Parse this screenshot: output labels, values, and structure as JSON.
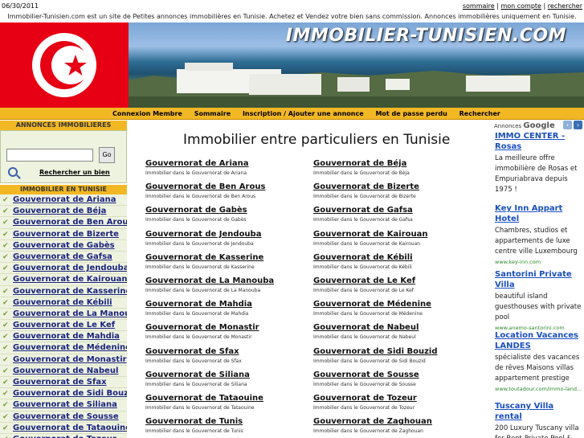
{
  "topbar": {
    "date": "06/30/2011",
    "links": [
      "sommaire",
      "mon compte",
      "rechercher"
    ],
    "separator": "|"
  },
  "intro": "Immobilier-Tunisien.com est un site de Petites annonces immobilières en Tunisie. Achetez et Vendez votre bien sans commission. Annonces immobilières uniquement en Tunisie.",
  "banner": {
    "logo_text": "IMMOBILIER-TUNISIEN.COM",
    "flag_colors": {
      "red": "#e70013",
      "white": "#ffffff"
    }
  },
  "nav": {
    "items": [
      "Connexion Membre",
      "Sommaire",
      "Inscription / Ajouter une annonce",
      "Mot de passe perdu",
      "Rechercher"
    ]
  },
  "left": {
    "header": "ANNONCES IMMOBILIERES",
    "search_value": "",
    "go_label": "Go",
    "search_link": "Rechercher un bien",
    "list_header": "IMMOBILIER EN TUNISIE",
    "items": [
      "Gouvernorat de Ariana",
      "Gouvernorat de Béja",
      "Gouvernorat de Ben Arous",
      "Gouvernorat de Bizerte",
      "Gouvernorat de Gabès",
      "Gouvernorat de Gafsa",
      "Gouvernorat de Jendouba",
      "Gouvernorat de Kairouan",
      "Gouvernorat de Kasserine",
      "Gouvernorat de Kébili",
      "Gouvernorat de La Manouba",
      "Gouvernorat de Le Kef",
      "Gouvernorat de Mahdia",
      "Gouvernorat de Médenine",
      "Gouvernorat de Monastir",
      "Gouvernorat de Nabeul",
      "Gouvernorat de Sfax",
      "Gouvernorat de Sidi Bouzid",
      "Gouvernorat de Siliana",
      "Gouvernorat de Sousse",
      "Gouvernorat de Tataouine",
      "Gouvernorat de Tozeur"
    ]
  },
  "main": {
    "title": "Immobilier entre particuliers en Tunisie",
    "entries": [
      {
        "title": "Gouvernorat de Ariana",
        "sub": "Immobilier dans le Gouvernorat de Ariana"
      },
      {
        "title": "Gouvernorat de Béja",
        "sub": "Immobilier dans le Gouvernorat de Béja"
      },
      {
        "title": "Gouvernorat de Ben Arous",
        "sub": "Immobilier dans le Gouvernorat de Ben Arous"
      },
      {
        "title": "Gouvernorat de Bizerte",
        "sub": "Immobilier dans le Gouvernorat de Bizerte"
      },
      {
        "title": "Gouvernorat de Gabès",
        "sub": "Immobilier dans le Gouvernorat de Gabès"
      },
      {
        "title": "Gouvernorat de Gafsa",
        "sub": "Immobilier dans le Gouvernorat de Gafsa"
      },
      {
        "title": "Gouvernorat de Jendouba",
        "sub": "Immobilier dans le Gouvernorat de Jendouba"
      },
      {
        "title": "Gouvernorat de Kairouan",
        "sub": "Immobilier dans le Gouvernorat de Kairouan"
      },
      {
        "title": "Gouvernorat de Kasserine",
        "sub": "Immobilier dans le Gouvernorat de Kasserine"
      },
      {
        "title": "Gouvernorat de Kébili",
        "sub": "Immobilier dans le Gouvernorat de Kébili"
      },
      {
        "title": "Gouvernorat de La Manouba",
        "sub": "Immobilier dans le Gouvernorat de La Manouba"
      },
      {
        "title": "Gouvernorat de Le Kef",
        "sub": "Immobilier dans le Gouvernorat de Le Kef"
      },
      {
        "title": "Gouvernorat de Mahdia",
        "sub": "Immobilier dans le Gouvernorat de Mahdia"
      },
      {
        "title": "Gouvernorat de Médenine",
        "sub": "Immobilier dans le Gouvernorat de Médenine"
      },
      {
        "title": "Gouvernorat de Monastir",
        "sub": "Immobilier dans le Gouvernorat de Monastir"
      },
      {
        "title": "Gouvernorat de Nabeul",
        "sub": "Immobilier dans le Gouvernorat de Nabeul"
      },
      {
        "title": "Gouvernorat de Sfax",
        "sub": "Immobilier dans le Gouvernorat de Sfax"
      },
      {
        "title": "Gouvernorat de Sidi Bouzid",
        "sub": "Immobilier dans le Gouvernorat de Sidi Bouzid"
      },
      {
        "title": "Gouvernorat de Siliana",
        "sub": "Immobilier dans le Gouvernorat de Siliana"
      },
      {
        "title": "Gouvernorat de Sousse",
        "sub": "Immobilier dans le Gouvernorat de Sousse"
      },
      {
        "title": "Gouvernorat de Tataouine",
        "sub": "Immobilier dans le Gouvernorat de Tataouine"
      },
      {
        "title": "Gouvernorat de Tozeur",
        "sub": "Immobilier dans le Gouvernorat de Tozeur"
      },
      {
        "title": "Gouvernorat de Tunis",
        "sub": "Immobilier dans le Gouvernorat de Tunis"
      },
      {
        "title": "Gouvernorat de Zaghouan",
        "sub": "Immobilier dans le Gouvernorat de Zaghouan"
      }
    ]
  },
  "ads": {
    "label_prefix": "Annonces",
    "label_brand": "Google",
    "items": [
      {
        "title": "IMMO CENTER - Rosas",
        "body": "La meilleure offre immobilière de Rosas et Empuriabrava depuis 1975 !",
        "url": ""
      },
      {
        "title": "Key Inn Appart Hotel",
        "body": "Chambres, studios et appartements de luxe centre ville Luxembourg",
        "url": "www.key-inn.com"
      },
      {
        "title": "Santorini Private Villa",
        "body": "beautiful island guesthouses with private pool",
        "url": "www.anemo-santorini.com"
      },
      {
        "title": "Location Vacances LANDES",
        "body": "spécialiste des vacances de rêves Maisons villas appartement prestige",
        "url": "www.toutadour.com/immo-land..."
      },
      {
        "title": "Tuscany Villa rental",
        "body": "200 Luxury Tuscany villa for Rent-Private Pool &",
        "url": ""
      }
    ]
  }
}
